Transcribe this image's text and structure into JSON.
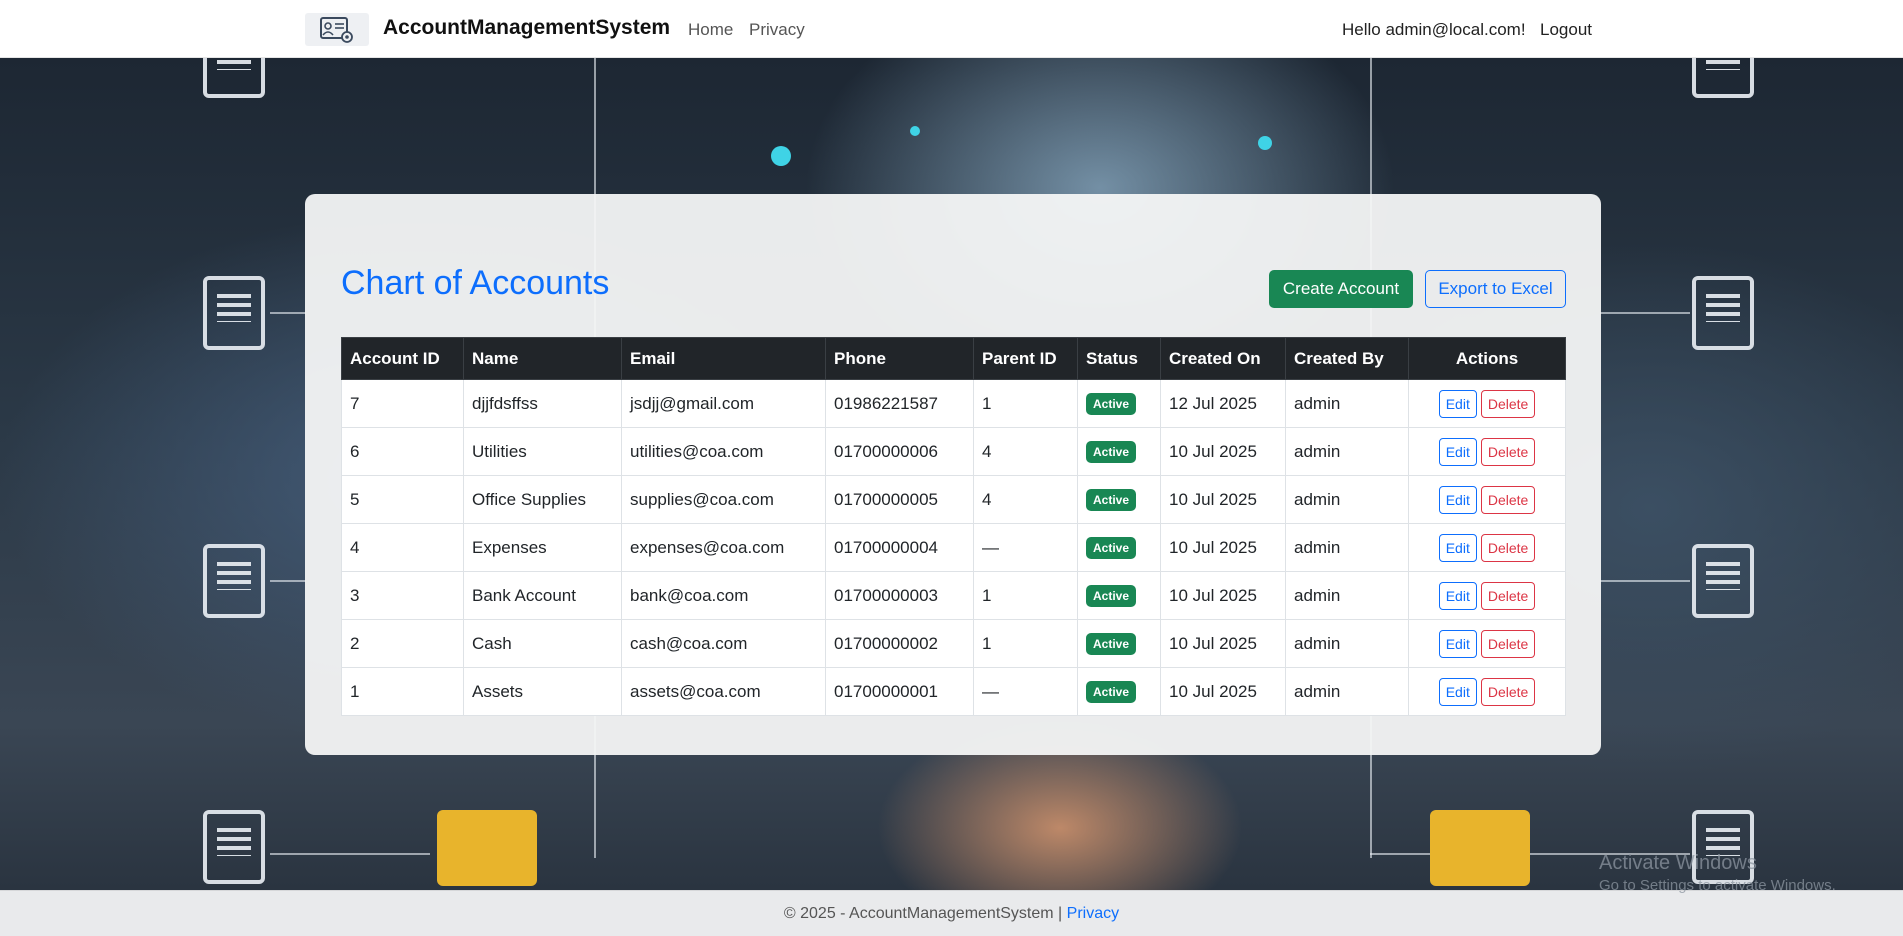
{
  "navbar": {
    "brand": "AccountManagementSystem",
    "links": [
      {
        "label": "Home"
      },
      {
        "label": "Privacy"
      }
    ],
    "greeting": "Hello admin@local.com!",
    "logout": "Logout"
  },
  "page": {
    "title": "Chart of Accounts",
    "create_label": "Create Account",
    "export_label": "Export to Excel"
  },
  "table": {
    "headers": [
      "Account ID",
      "Name",
      "Email",
      "Phone",
      "Parent ID",
      "Status",
      "Created On",
      "Created By",
      "Actions"
    ],
    "edit_label": "Edit",
    "delete_label": "Delete",
    "rows": [
      {
        "id": "7",
        "name": "djjfdsffss",
        "email": "jsdjj@gmail.com",
        "phone": "01986221587",
        "parent": "1",
        "status": "Active",
        "created_on": "12 Jul 2025",
        "created_by": "admin"
      },
      {
        "id": "6",
        "name": "Utilities",
        "email": "utilities@coa.com",
        "phone": "01700000006",
        "parent": "4",
        "status": "Active",
        "created_on": "10 Jul 2025",
        "created_by": "admin"
      },
      {
        "id": "5",
        "name": "Office Supplies",
        "email": "supplies@coa.com",
        "phone": "01700000005",
        "parent": "4",
        "status": "Active",
        "created_on": "10 Jul 2025",
        "created_by": "admin"
      },
      {
        "id": "4",
        "name": "Expenses",
        "email": "expenses@coa.com",
        "phone": "01700000004",
        "parent": "—",
        "status": "Active",
        "created_on": "10 Jul 2025",
        "created_by": "admin"
      },
      {
        "id": "3",
        "name": "Bank Account",
        "email": "bank@coa.com",
        "phone": "01700000003",
        "parent": "1",
        "status": "Active",
        "created_on": "10 Jul 2025",
        "created_by": "admin"
      },
      {
        "id": "2",
        "name": "Cash",
        "email": "cash@coa.com",
        "phone": "01700000002",
        "parent": "1",
        "status": "Active",
        "created_on": "10 Jul 2025",
        "created_by": "admin"
      },
      {
        "id": "1",
        "name": "Assets",
        "email": "assets@coa.com",
        "phone": "01700000001",
        "parent": "—",
        "status": "Active",
        "created_on": "10 Jul 2025",
        "created_by": "admin"
      }
    ]
  },
  "footer": {
    "text": "© 2025 - AccountManagementSystem |",
    "privacy": "Privacy"
  },
  "watermark": {
    "line1": "Activate Windows",
    "line2": "Go to Settings to activate Windows."
  },
  "colors": {
    "primary": "#0d6efd",
    "success": "#198754",
    "danger": "#dc3545",
    "header_dark": "#212529"
  },
  "icons": {
    "logo": "account-settings-icon"
  }
}
